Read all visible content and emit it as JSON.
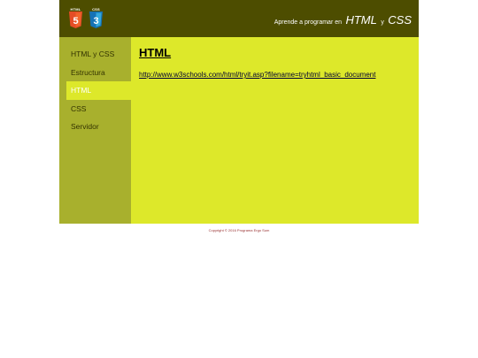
{
  "header": {
    "logos": [
      {
        "label": "HTML",
        "digit": "5",
        "icon": "html5-icon",
        "color": "#e44d26"
      },
      {
        "label": "CSS",
        "digit": "3",
        "icon": "css3-icon",
        "color": "#1572b6"
      }
    ],
    "tagline_prefix": "Aprende a programar en",
    "tagline_html": "HTML",
    "tagline_and": "y",
    "tagline_css": "CSS"
  },
  "sidebar": {
    "items": [
      {
        "label": "HTML y CSS",
        "active": false
      },
      {
        "label": "Estructura",
        "active": false
      },
      {
        "label": "HTML",
        "active": true
      },
      {
        "label": "CSS",
        "active": false
      },
      {
        "label": "Servidor",
        "active": false
      }
    ]
  },
  "content": {
    "title": "HTML",
    "link_text": "http://www.w3schools.com/html/tryit.asp?filename=tryhtml_basic_document"
  },
  "footer": {
    "copyright": "Copyright © 2016 Programa Ergo Sum"
  },
  "colors": {
    "header_bg": "#4d4d00",
    "sidebar_bg": "#a8b02d",
    "content_bg": "#dde82a",
    "footer_text": "#993333"
  }
}
